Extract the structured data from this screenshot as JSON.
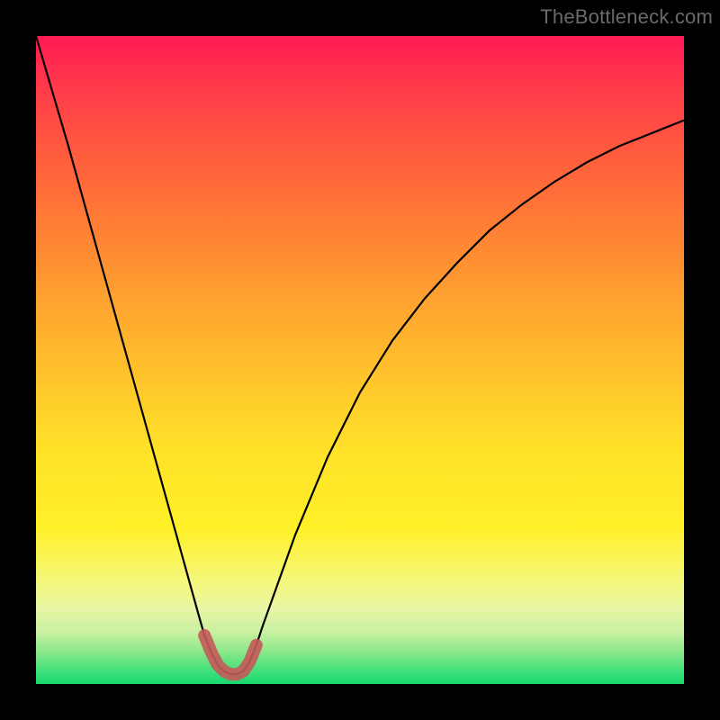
{
  "watermark": "TheBottleneck.com",
  "colors": {
    "bg": "#000000",
    "curve": "#000000",
    "marker": "#c45a5a",
    "marker_fill": "#c86a6a"
  },
  "chart_data": {
    "type": "line",
    "title": "",
    "xlabel": "",
    "ylabel": "",
    "xlim": [
      0,
      100
    ],
    "ylim": [
      0,
      100
    ],
    "x": [
      0,
      5,
      10,
      15,
      17.5,
      20,
      22.5,
      25,
      26,
      27,
      28,
      29,
      30,
      31,
      32,
      33,
      34,
      35,
      37.5,
      40,
      45,
      50,
      55,
      60,
      65,
      70,
      75,
      80,
      85,
      90,
      95,
      100
    ],
    "series": [
      {
        "name": "bottleneck-curve",
        "values": [
          100,
          83,
          65,
          47,
          38,
          29,
          20,
          11,
          7.5,
          5,
          3,
          2,
          1.5,
          1.5,
          2,
          3.5,
          6,
          9,
          16,
          23,
          35,
          45,
          53,
          59.5,
          65,
          70,
          74,
          77.5,
          80.5,
          83,
          85,
          87
        ]
      }
    ],
    "highlight": {
      "name": "optimal-range",
      "x": [
        26,
        27,
        28,
        29,
        30,
        31,
        32,
        33,
        34
      ],
      "values": [
        7.5,
        5,
        3,
        2,
        1.5,
        1.5,
        2,
        3.5,
        6
      ]
    },
    "annotations": []
  }
}
